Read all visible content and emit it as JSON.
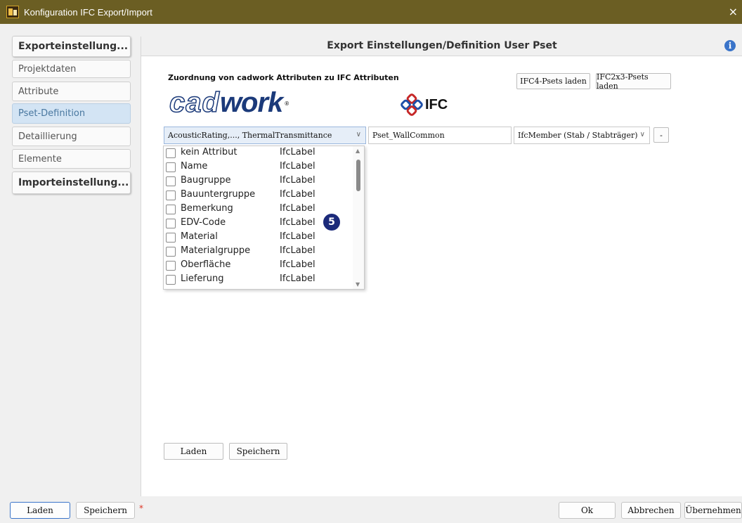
{
  "window": {
    "title": "Konfiguration IFC Export/Import",
    "close_glyph": "×"
  },
  "sidebar": {
    "export_section": "Exporteinstellung...",
    "items": [
      {
        "label": "Projektdaten",
        "active": false
      },
      {
        "label": "Attribute",
        "active": false
      },
      {
        "label": "Pset-Definition",
        "active": true
      },
      {
        "label": "Detaillierung",
        "active": false
      },
      {
        "label": "Elemente",
        "active": false
      }
    ],
    "import_section": "Importeinstellung..."
  },
  "main": {
    "header_title": "Export Einstellungen/Definition User Pset",
    "info_glyph": "i",
    "assign_label": "Zuordnung von cadwork Attributen zu IFC Attributen",
    "logos": {
      "cadwork_cad": "cad",
      "cadwork_work": "work",
      "cadwork_reg": "®",
      "ifc_text": "IFC"
    },
    "buttons": {
      "ifc4_psets": "IFC4-Psets laden",
      "ifc2x3_psets": "IFC2x3-Psets laden",
      "remove": "-",
      "load": "Laden",
      "save": "Speichern"
    },
    "attributes_combo": {
      "value": "AcousticRating,..., ThermalTransmittance",
      "chevron": "∨"
    },
    "pset_name": "Pset_WallCommon",
    "ifc_type_combo": {
      "value": "IfcMember (Stab / Stabträger)",
      "chevron": "∨"
    },
    "dropdown_items": [
      {
        "name": "kein Attribut",
        "type": "IfcLabel",
        "checked": false
      },
      {
        "name": "Name",
        "type": "IfcLabel",
        "checked": false
      },
      {
        "name": "Baugruppe",
        "type": "IfcLabel",
        "checked": false
      },
      {
        "name": "Bauuntergruppe",
        "type": "IfcLabel",
        "checked": false
      },
      {
        "name": "Bemerkung",
        "type": "IfcLabel",
        "checked": false
      },
      {
        "name": "EDV-Code",
        "type": "IfcLabel",
        "checked": false
      },
      {
        "name": "Material",
        "type": "IfcLabel",
        "checked": false
      },
      {
        "name": "Materialgruppe",
        "type": "IfcLabel",
        "checked": false
      },
      {
        "name": "Oberfläche",
        "type": "IfcLabel",
        "checked": false
      },
      {
        "name": "Lieferung",
        "type": "IfcLabel",
        "checked": false
      }
    ],
    "callout_badge": "5"
  },
  "footer": {
    "load": "Laden",
    "save": "Speichern",
    "modified_marker": "*",
    "ok": "Ok",
    "cancel": "Abbrechen",
    "apply": "Übernehmen"
  },
  "colors": {
    "titlebar": "#6b5e23",
    "active_item": "#d3e4f4",
    "badge": "#1b2a7a",
    "cadwork_blue": "#1b3a7a"
  }
}
